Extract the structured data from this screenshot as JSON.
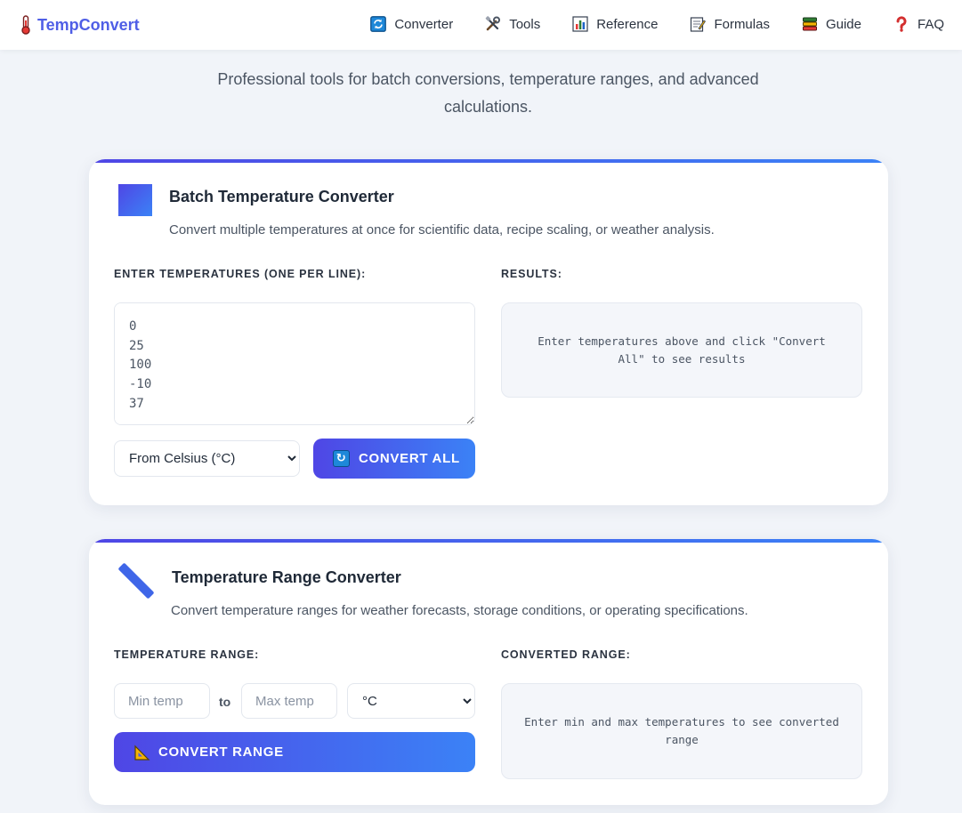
{
  "brand": {
    "name": "TempConvert",
    "icon": "thermometer-icon"
  },
  "nav": [
    {
      "label": "Converter",
      "icon": "refresh-icon"
    },
    {
      "label": "Tools",
      "icon": "tools-icon"
    },
    {
      "label": "Reference",
      "icon": "bar-chart-icon"
    },
    {
      "label": "Formulas",
      "icon": "memo-icon"
    },
    {
      "label": "Guide",
      "icon": "books-icon"
    },
    {
      "label": "FAQ",
      "icon": "question-icon"
    }
  ],
  "subtitle": "Professional tools for batch conversions, temperature ranges, and advanced calculations.",
  "batch": {
    "title": "Batch Temperature Converter",
    "description": "Convert multiple temperatures at once for scientific data, recipe scaling, or weather analysis.",
    "input_label": "ENTER TEMPERATURES (ONE PER LINE):",
    "input_value": "0\n25\n100\n-10\n37",
    "results_label": "RESULTS:",
    "unit_selected": "From Celsius (°C)",
    "button_label": "CONVERT ALL",
    "results_placeholder": "Enter temperatures above and click \"Convert All\" to see results",
    "accent": "#4f46e5"
  },
  "range": {
    "title": "Temperature Range Converter",
    "description": "Convert temperature ranges for weather forecasts, storage conditions, or operating specifications.",
    "input_label": "TEMPERATURE RANGE:",
    "min_placeholder": "Min temp",
    "to_label": "to",
    "max_placeholder": "Max temp",
    "unit_selected": "°C",
    "button_label": "CONVERT RANGE",
    "results_label": "CONVERTED RANGE:",
    "results_placeholder": "Enter min and max temperatures to see converted range"
  }
}
